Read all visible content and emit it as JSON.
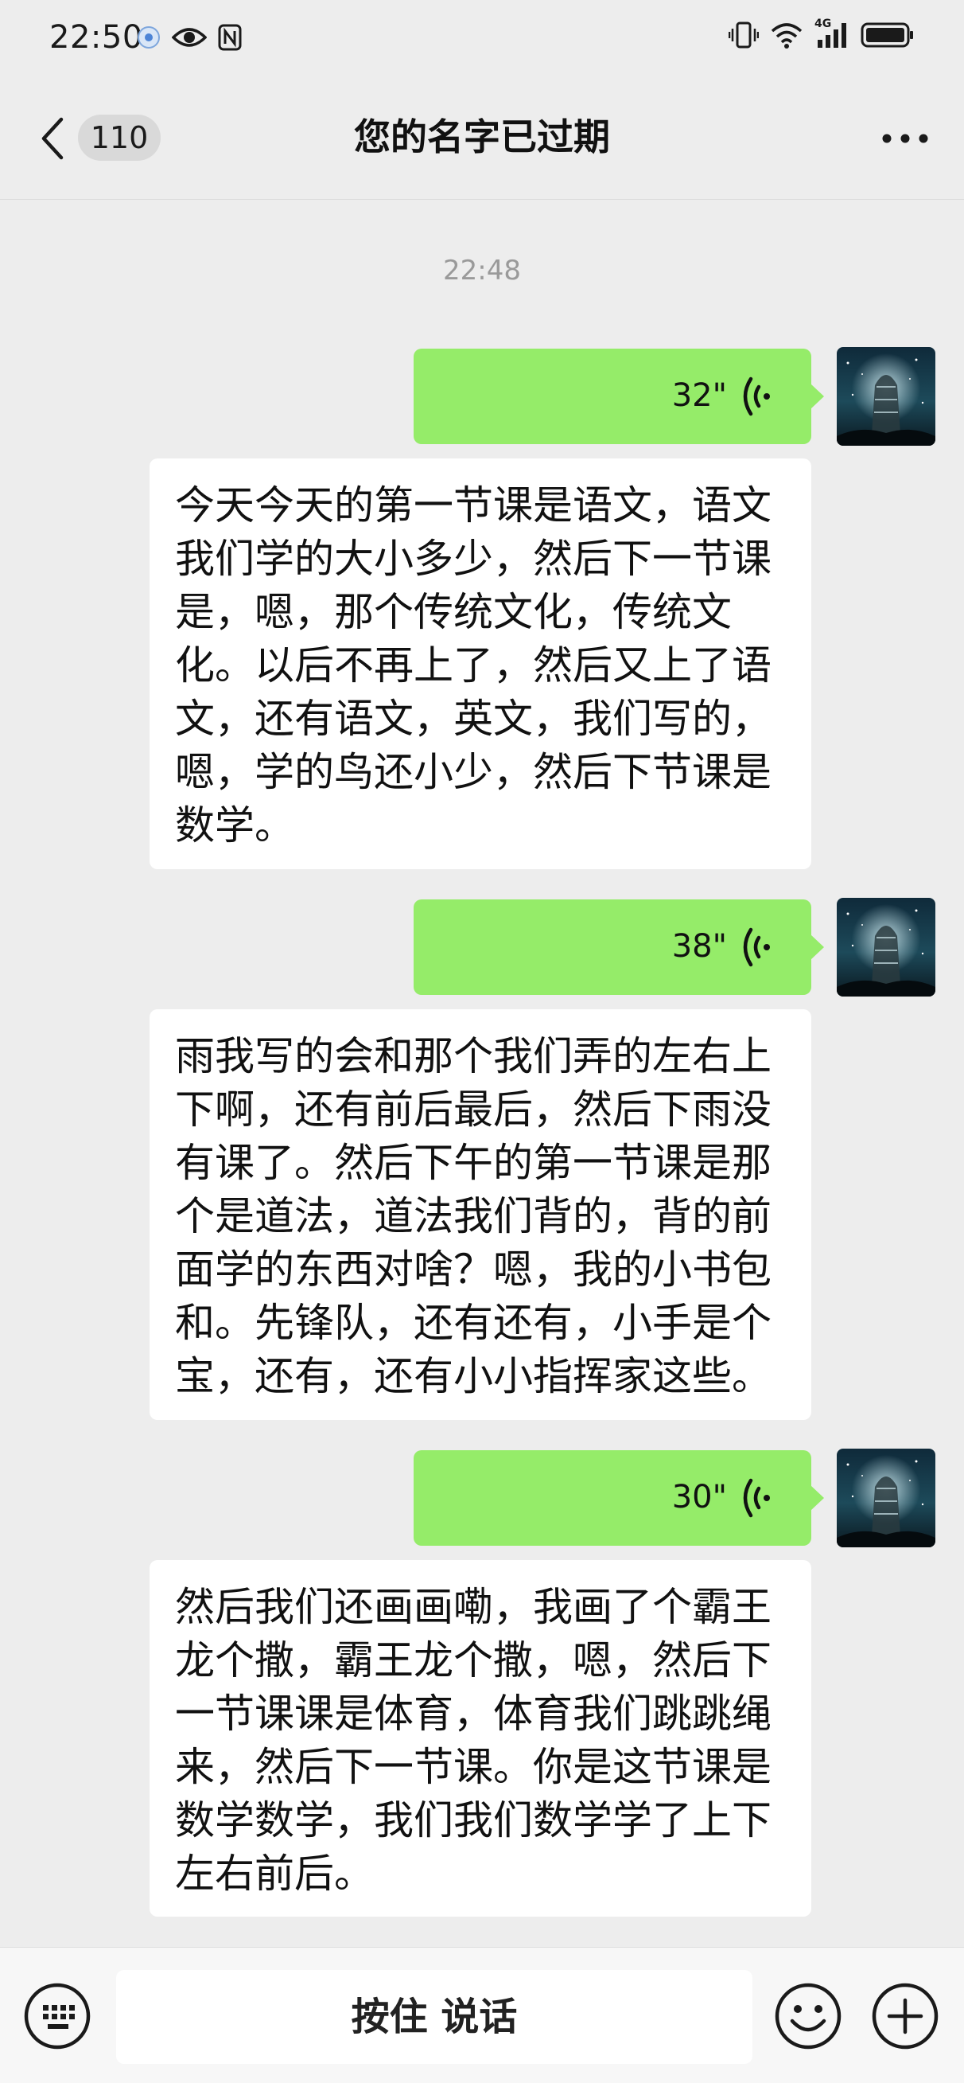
{
  "status_bar": {
    "time": "22:50",
    "left_icons": [
      "location-dot-icon",
      "eye-icon",
      "nfc-icon"
    ],
    "right_icons": [
      "vibrate-icon",
      "wifi-icon",
      "signal-4g-icon",
      "battery-icon"
    ],
    "network_label": "4G"
  },
  "header": {
    "back_label": "<",
    "unread_count": "110",
    "title": "您的名字已过期",
    "more_label": "···"
  },
  "conversation": {
    "timestamp": "22:48",
    "messages": [
      {
        "voice_duration": "32\"",
        "transcript": "今天今天的第一节课是语文，语文我们学的大小多少，然后下一节课是，嗯，那个传统文化，传统文化。以后不再上了，然后又上了语文，还有语文，英文，我们写的，嗯，学的鸟还小少，然后下节课是数学。"
      },
      {
        "voice_duration": "38\"",
        "transcript": "雨我写的会和那个我们弄的左右上下啊，还有前后最后，然后下雨没有课了。然后下午的第一节课是那个是道法，道法我们背的，背的前面学的东西对啥？嗯，我的小书包和。先锋队，还有还有，小手是个宝，还有，还有小小指挥家这些。"
      },
      {
        "voice_duration": "30\"",
        "transcript": "然后我们还画画嘞，我画了个霸王龙个撒，霸王龙个撒，嗯，然后下一节课课是体育，体育我们跳跳绳来，然后下一节课。你是这节课是数学数学，我们我们数学学了上下左右前后。"
      }
    ]
  },
  "input_bar": {
    "hold_to_talk_label": "按住 说话"
  },
  "colors": {
    "background": "#ededed",
    "voice_bubble": "#95ec69",
    "transcript_bubble": "#ffffff",
    "timestamp_text": "#9a9a9a"
  }
}
